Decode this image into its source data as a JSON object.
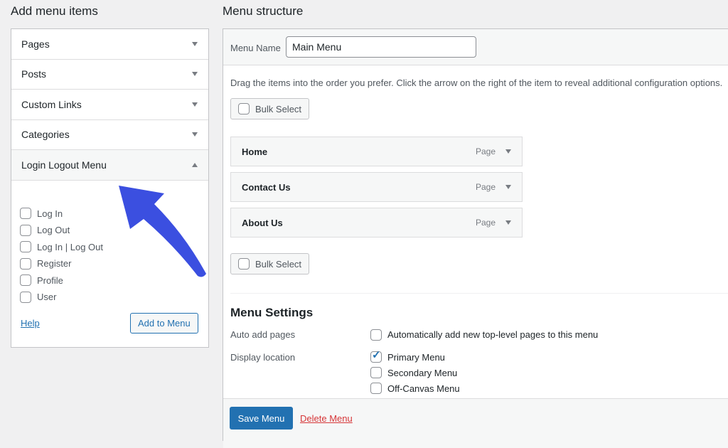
{
  "left": {
    "title": "Add menu items",
    "accordions": [
      {
        "label": "Pages"
      },
      {
        "label": "Posts"
      },
      {
        "label": "Custom Links"
      },
      {
        "label": "Categories"
      },
      {
        "label": "Login Logout Menu",
        "open": true
      }
    ],
    "login_items": [
      "Log In",
      "Log Out",
      "Log In | Log Out",
      "Register",
      "Profile",
      "User"
    ],
    "help": "Help",
    "add_button": "Add to Menu"
  },
  "right": {
    "title": "Menu structure",
    "menu_name_label": "Menu Name",
    "menu_name_value": "Main Menu",
    "instructions": "Drag the items into the order you prefer. Click the arrow on the right of the item to reveal additional configuration options.",
    "bulk_select": "Bulk Select",
    "items": [
      {
        "title": "Home",
        "type": "Page"
      },
      {
        "title": "Contact Us",
        "type": "Page"
      },
      {
        "title": "About Us",
        "type": "Page"
      }
    ],
    "settings": {
      "title": "Menu Settings",
      "auto_add_label": "Auto add pages",
      "auto_add_option": "Automatically add new top-level pages to this menu",
      "display_label": "Display location",
      "locations": [
        {
          "label": "Primary Menu",
          "checked": true
        },
        {
          "label": "Secondary Menu",
          "checked": false
        },
        {
          "label": "Off-Canvas Menu",
          "checked": false
        }
      ]
    },
    "save": "Save Menu",
    "delete": "Delete Menu"
  },
  "colors": {
    "arrow": "#3b4fe0",
    "primary": "#2271b1",
    "delete": "#d63638"
  }
}
